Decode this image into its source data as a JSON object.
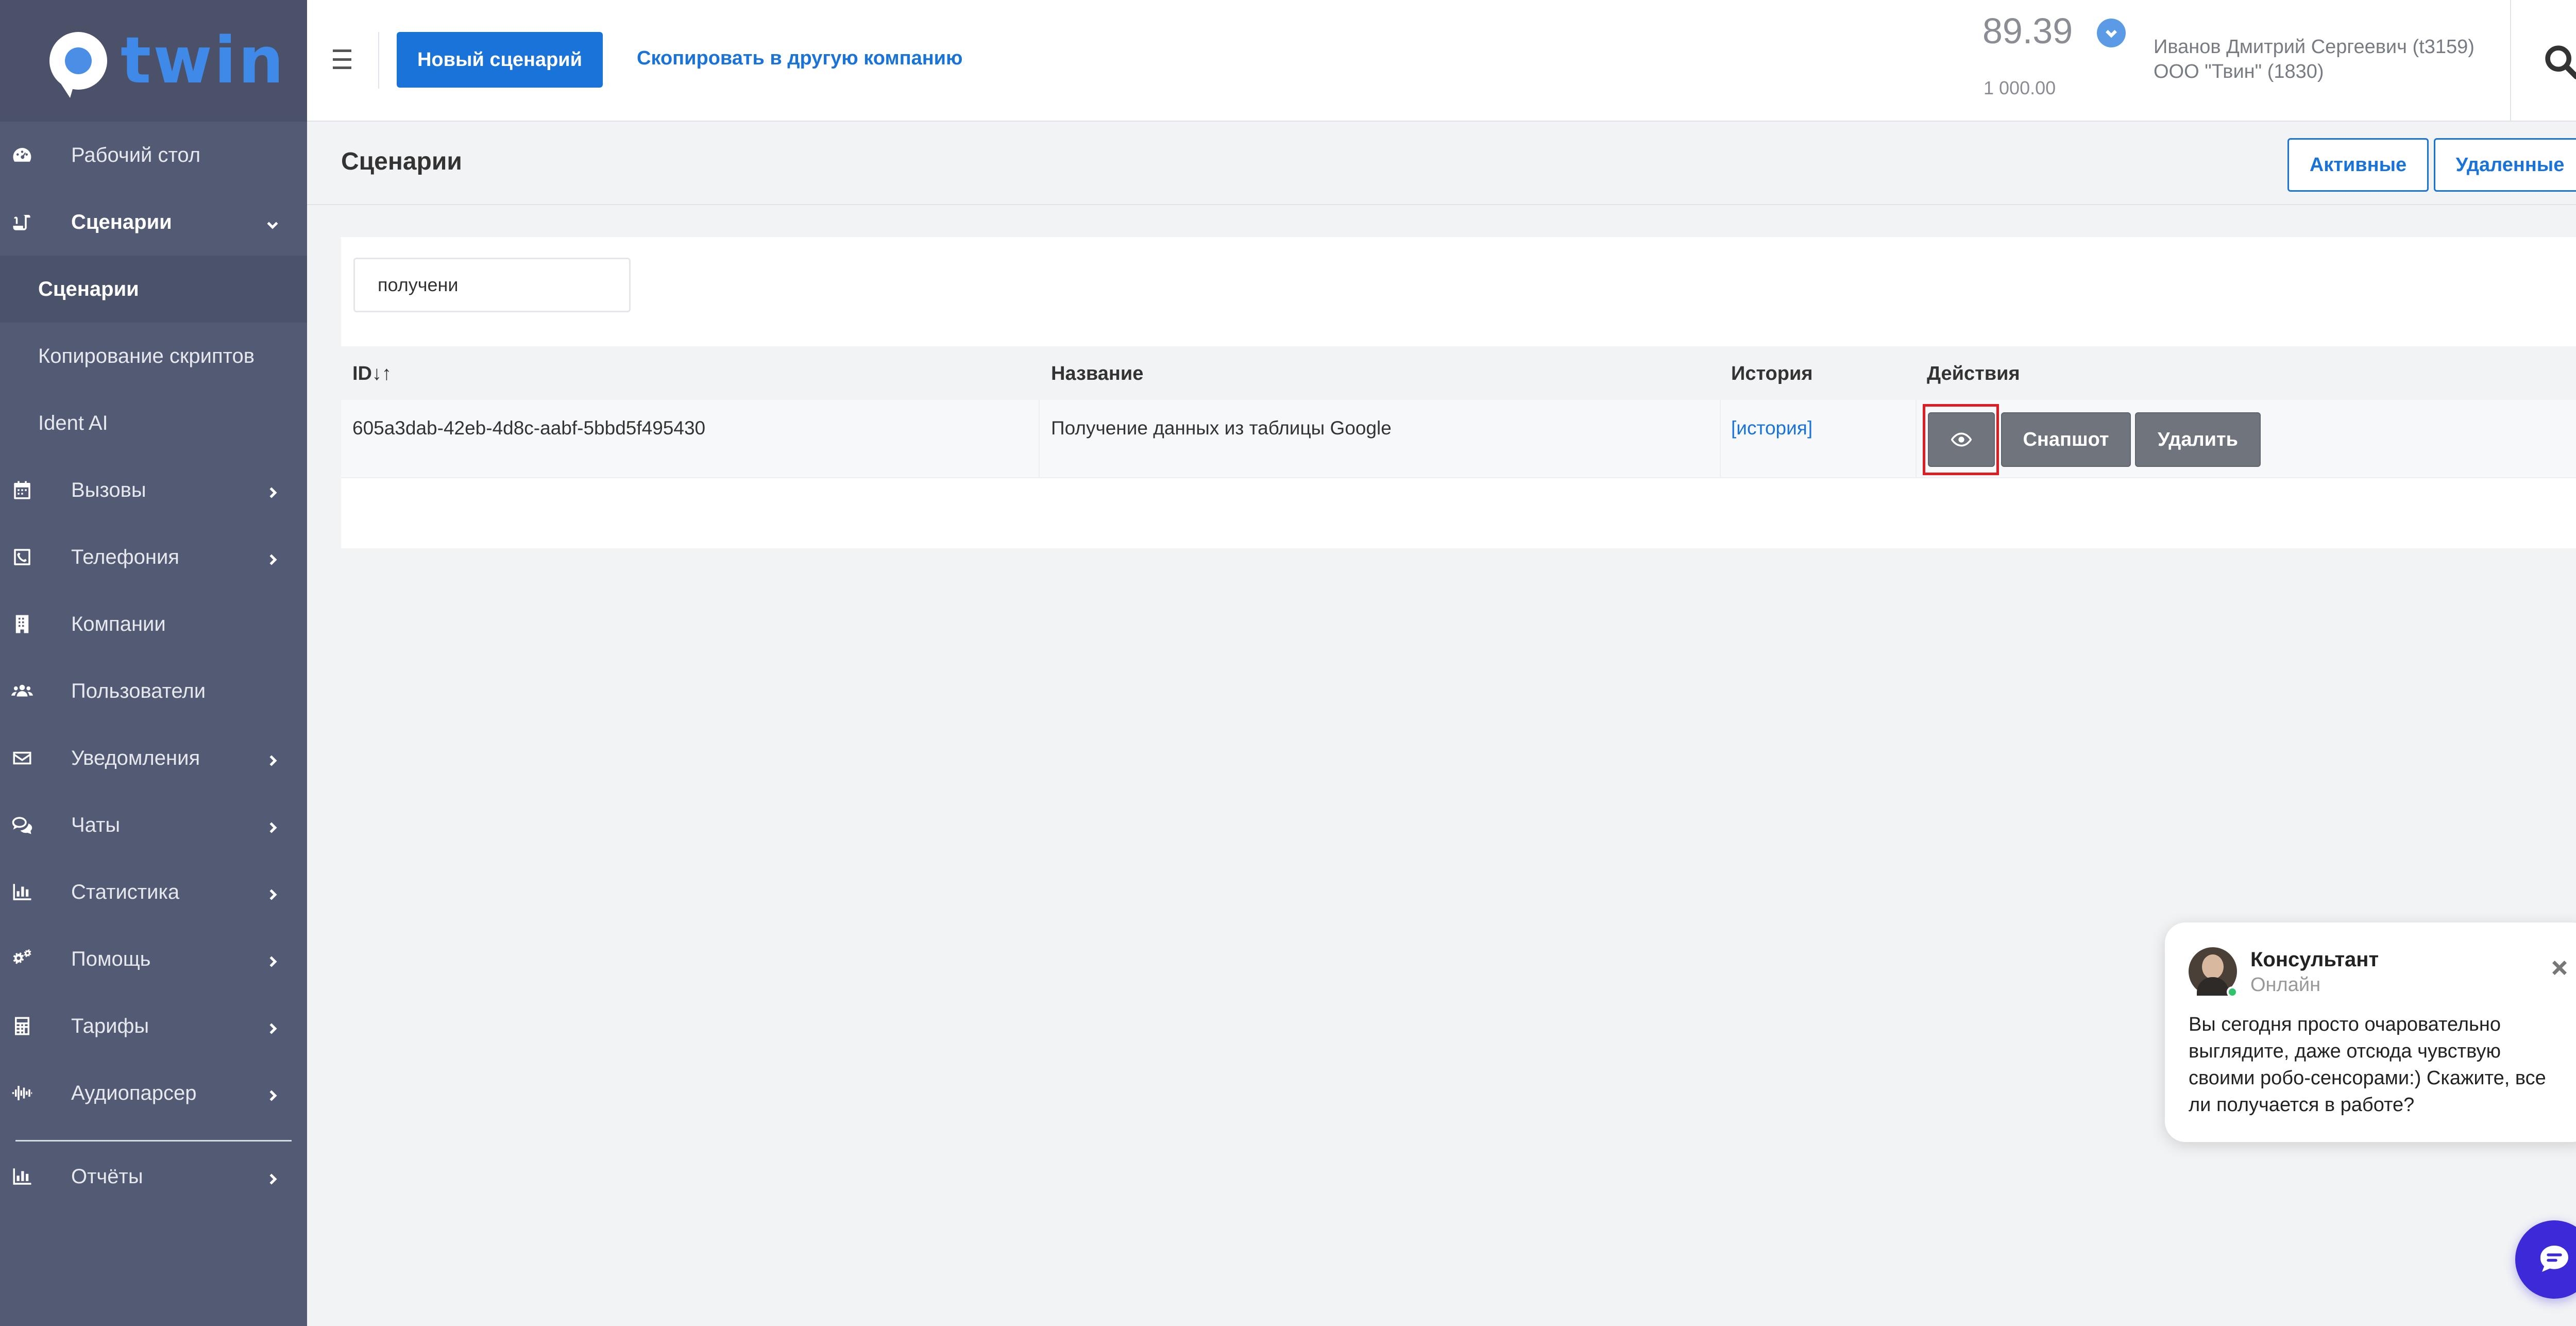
{
  "logo": {
    "text": "twin"
  },
  "sidebar": {
    "items": [
      {
        "label": "Рабочий стол",
        "icon": "dashboard-icon",
        "has_children": false
      },
      {
        "label": "Сценарии",
        "icon": "scroll-icon",
        "has_children": true,
        "expanded": true,
        "children": [
          {
            "label": "Сценарии",
            "active": true
          },
          {
            "label": "Копирование скриптов",
            "active": false
          },
          {
            "label": "Ident AI",
            "active": false
          }
        ]
      },
      {
        "label": "Вызовы",
        "icon": "calendar-icon",
        "has_children": true
      },
      {
        "label": "Телефония",
        "icon": "phone-square-icon",
        "has_children": true
      },
      {
        "label": "Компании",
        "icon": "building-icon",
        "has_children": false
      },
      {
        "label": "Пользователи",
        "icon": "users-icon",
        "has_children": false
      },
      {
        "label": "Уведомления",
        "icon": "envelope-icon",
        "has_children": true
      },
      {
        "label": "Чаты",
        "icon": "chat-bubbles-icon",
        "has_children": true
      },
      {
        "label": "Статистика",
        "icon": "bar-chart-icon",
        "has_children": true
      },
      {
        "label": "Помощь",
        "icon": "gears-icon",
        "has_children": true
      },
      {
        "label": "Тарифы",
        "icon": "calculator-icon",
        "has_children": true
      },
      {
        "label": "Аудиопарсер",
        "icon": "waveform-icon",
        "has_children": true
      },
      {
        "label": "Отчёты",
        "icon": "bar-chart-icon",
        "has_children": true
      }
    ]
  },
  "header": {
    "new_scenario_label": "Новый сценарий",
    "copy_link_label": "Скопировать в другую компанию",
    "balance": "89.39",
    "balance_sub": "1 000.00",
    "user_name": "Иванов Дмитрий Сергеевич (t3159)",
    "user_company": "ООО \"Твин\" (1830)"
  },
  "page": {
    "title": "Сценарии",
    "filter_active_label": "Активные",
    "filter_deleted_label": "Удаленные"
  },
  "search": {
    "value": "получени"
  },
  "table": {
    "columns": [
      "ID",
      "Название",
      "История",
      "Действия"
    ],
    "sort_glyph": "↓↑",
    "rows": [
      {
        "id": "605a3dab-42eb-4d8c-aabf-5bbd5f495430",
        "name": "Получение данных из таблицы Google",
        "history": "[история]",
        "actions": {
          "snapshot_label": "Снапшот",
          "delete_label": "Удалить"
        }
      }
    ]
  },
  "consultant": {
    "name": "Консультант",
    "status": "Онлайн",
    "message": "Вы сегодня просто очаровательно выглядите, даже отсюда чувствую своими робо-сенсорами:) Скажите, все ли получается в работе?"
  },
  "colors": {
    "sidebar_bg": "#525b73",
    "primary": "#1a73d9",
    "action_button": "#6f747d",
    "highlight": "#e11b22",
    "chat_fab": "#3c2ad9"
  }
}
